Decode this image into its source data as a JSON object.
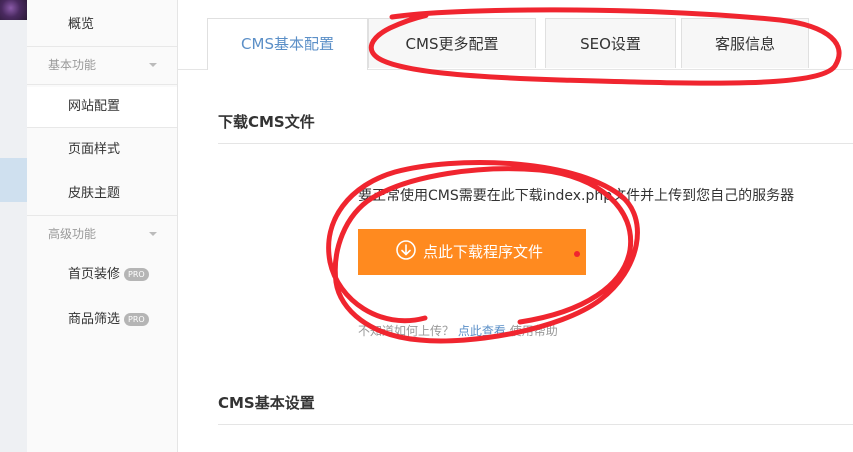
{
  "sidebar": {
    "items": [
      {
        "label": "概览"
      },
      {
        "group": "基本功能"
      },
      {
        "label": "网站配置",
        "active": true
      },
      {
        "label": "页面样式"
      },
      {
        "label": "皮肤主题"
      },
      {
        "group": "高级功能"
      },
      {
        "label": "首页装修",
        "badge": "PRO"
      },
      {
        "label": "商品筛选",
        "badge": "PRO"
      }
    ]
  },
  "tabs": [
    {
      "label": "CMS基本配置",
      "active": true
    },
    {
      "label": "CMS更多配置"
    },
    {
      "label": "SEO设置"
    },
    {
      "label": "客服信息"
    }
  ],
  "download": {
    "title": "下载CMS文件",
    "description": "要正常使用CMS需要在此下载index.php文件并上传到您自己的服务器",
    "button_label": "点此下载程序文件",
    "help_prefix": "不知道如何上传？",
    "help_link": "点此查看",
    "help_suffix": "使用帮助"
  },
  "settings": {
    "title": "CMS基本设置"
  },
  "colors": {
    "accent_blue": "#5b8fc7",
    "button_orange": "#ff8a1f",
    "annotation_red": "#f0252f"
  }
}
